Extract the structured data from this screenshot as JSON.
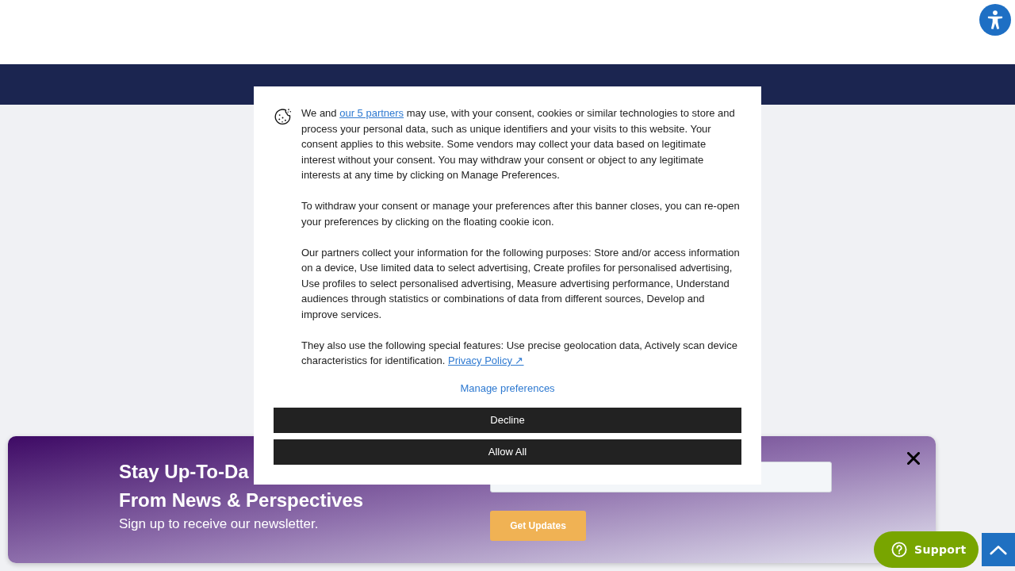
{
  "cookie_banner": {
    "paragraphs": [
      [
        {
          "kind": "text",
          "text": "We and "
        },
        {
          "kind": "link",
          "text": "our 5 partners"
        },
        {
          "kind": "text",
          "text": " may use, with your consent, cookies or similar technologies to store and process your personal data, such as unique identifiers and your visits to this website. Your consent applies to this website. Some vendors may collect your data based on legitimate interest without your consent. You may withdraw your consent or object to any legitimate interests at any time by clicking on Manage Preferences."
        }
      ],
      [
        {
          "kind": "text",
          "text": "To withdraw your consent or manage your preferences after this banner closes, you can re-open your preferences by clicking on the floating cookie icon."
        }
      ],
      [
        {
          "kind": "text",
          "text": "Our partners collect your information for the following purposes: Store and/or access information on a device, Use limited data to select advertising, Create profiles for personalised advertising, Use profiles to select personalised advertising, Measure advertising performance, Understand audiences through statistics or combinations of data from different sources, Develop and improve services."
        }
      ],
      [
        {
          "kind": "text",
          "text": "They also use the following special features: Use precise geolocation data, Actively scan device characteristics for identification. "
        },
        {
          "kind": "link",
          "text": "Privacy Policy ↗"
        }
      ]
    ],
    "manage_link": "Manage preferences",
    "buttons": [
      "Decline",
      "Allow All"
    ]
  },
  "newsletter": {
    "heading_lines": [
      "Stay Up-To-Da",
      "From News & Perspectives"
    ],
    "subtitle": "Sign up to receive our newsletter.",
    "submit_button": "Get Updates"
  },
  "support_button": {
    "label": "Support"
  }
}
